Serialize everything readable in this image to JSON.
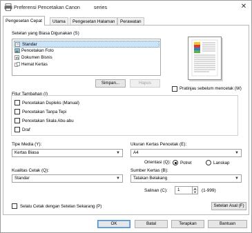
{
  "window": {
    "title": "Preferensi Pencetakan Canon",
    "title_suffix": "series",
    "close": "✕"
  },
  "tabs": [
    {
      "label": "Pengesetan Cepat"
    },
    {
      "label": "Utama"
    },
    {
      "label": "Pengesetan Halaman"
    },
    {
      "label": "Perawatan"
    }
  ],
  "common_settings": {
    "label": "Setelan yang Biasa Digunakan (S)",
    "items": [
      {
        "label": "Standar"
      },
      {
        "label": "Pencetakan Foto"
      },
      {
        "label": "Dokumen Bisnis"
      },
      {
        "label": "Hemat Kertas"
      }
    ],
    "save_button": "Simpan...",
    "delete_button": "Hapus"
  },
  "preview": {
    "checkbox_label": "Pratinjau sebelum mencetak (W)"
  },
  "additional": {
    "label": "Fitur Tambahan (I)",
    "options": [
      {
        "label": "Pencetakan Dupleks (Manual)"
      },
      {
        "label": "Pencetakan Tanpa Tepi"
      },
      {
        "label": "Pencetakan Skala Abu-abu"
      },
      {
        "label": "Draf"
      }
    ]
  },
  "media": {
    "label": "Tipe Media (Y):",
    "value": "Kertas Biasa"
  },
  "paper_size": {
    "label": "Ukuran Kertas Pencetak (E):",
    "value": "A4"
  },
  "orientation": {
    "label": "Orientasi (Q):",
    "portrait": "Potret",
    "landscape": "Lanskap"
  },
  "quality": {
    "label": "Kualitas Cetak (Q):",
    "value": "Standar"
  },
  "paper_source": {
    "label": "Sumber Kertas (B):",
    "value": "Tatakan Belakang"
  },
  "copies": {
    "label": "Salinan (C):",
    "value": "1",
    "range": "(1-999)"
  },
  "always_print": {
    "label": "Selalu Cetak dengan Setelan Sekarang (P)"
  },
  "defaults_button": "Setelan Asal (F)",
  "footer": {
    "ok": "OK",
    "cancel": "Batal",
    "apply": "Terapkan",
    "help": "Bantuan"
  }
}
